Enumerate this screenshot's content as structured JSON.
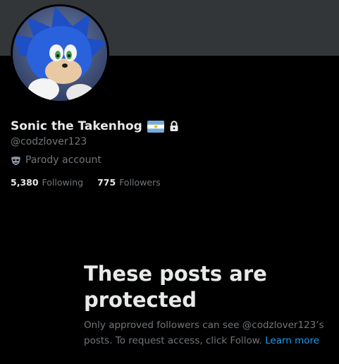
{
  "profile": {
    "display_name": "Sonic the Takenhog",
    "handle": "@codzlover123",
    "label": "Parody account",
    "flag_icon": "argentina-flag-icon",
    "lock_icon": "lock-icon",
    "label_icon": "mask-icon",
    "avatar_alt": "sonic-avatar"
  },
  "stats": {
    "following_count": "5,380",
    "following_label": "Following",
    "followers_count": "775",
    "followers_label": "Followers"
  },
  "protected": {
    "title": "These posts are protected",
    "description": "Only approved followers can see @codzlover123’s posts. To request access, click Follow.",
    "learn_more": "Learn more"
  },
  "colors": {
    "background": "#000000",
    "banner": "#333639",
    "primary_text": "#e7e9ea",
    "secondary_text": "#71767b",
    "link": "#1d9bf0"
  }
}
